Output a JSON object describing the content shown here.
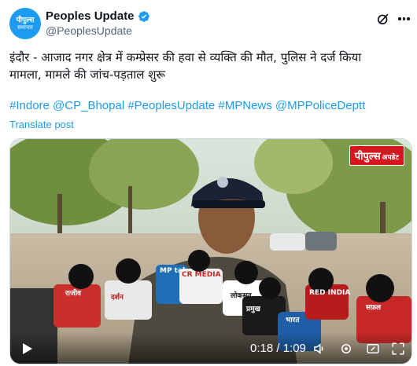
{
  "post": {
    "avatar_line1": "पीपुल्स",
    "avatar_line2": "समाचार",
    "display_name": "Peoples Update",
    "handle": "@PeoplesUpdate",
    "text_line1": "इंदौर - आजाद नगर क्षेत्र में कम्प्रेसर की हवा से व्यक्ति की मौत, पुलिस ने दर्ज किया",
    "text_line2": "मामला, मामले की जांच-पड़ताल शुरू",
    "hashtags": "#Indore @CP_Bhopal #PeoplesUpdate #MPNews @MPPoliceDeptt",
    "translate_label": "Translate post"
  },
  "video": {
    "watermark_main": "पीपुल्स",
    "watermark_sub": "अपडेट",
    "mic_labels": [
      "MP tak",
      "CR MEDIA",
      "राजीव",
      "दर्शन",
      "लोकसत",
      "भारत",
      "RED INDIA",
      "सफ़ल",
      "प्रमुख"
    ],
    "timecode": "0:18 / 1:09",
    "progress": 0.26
  },
  "colors": {
    "brand_blue": "#1d9bf0",
    "watermark_red": "#d6161c"
  },
  "icons": [
    "verified-badge-icon",
    "grok-icon",
    "more-options-icon",
    "play-icon",
    "volume-icon",
    "settings-icon",
    "fullscreen-icon"
  ]
}
